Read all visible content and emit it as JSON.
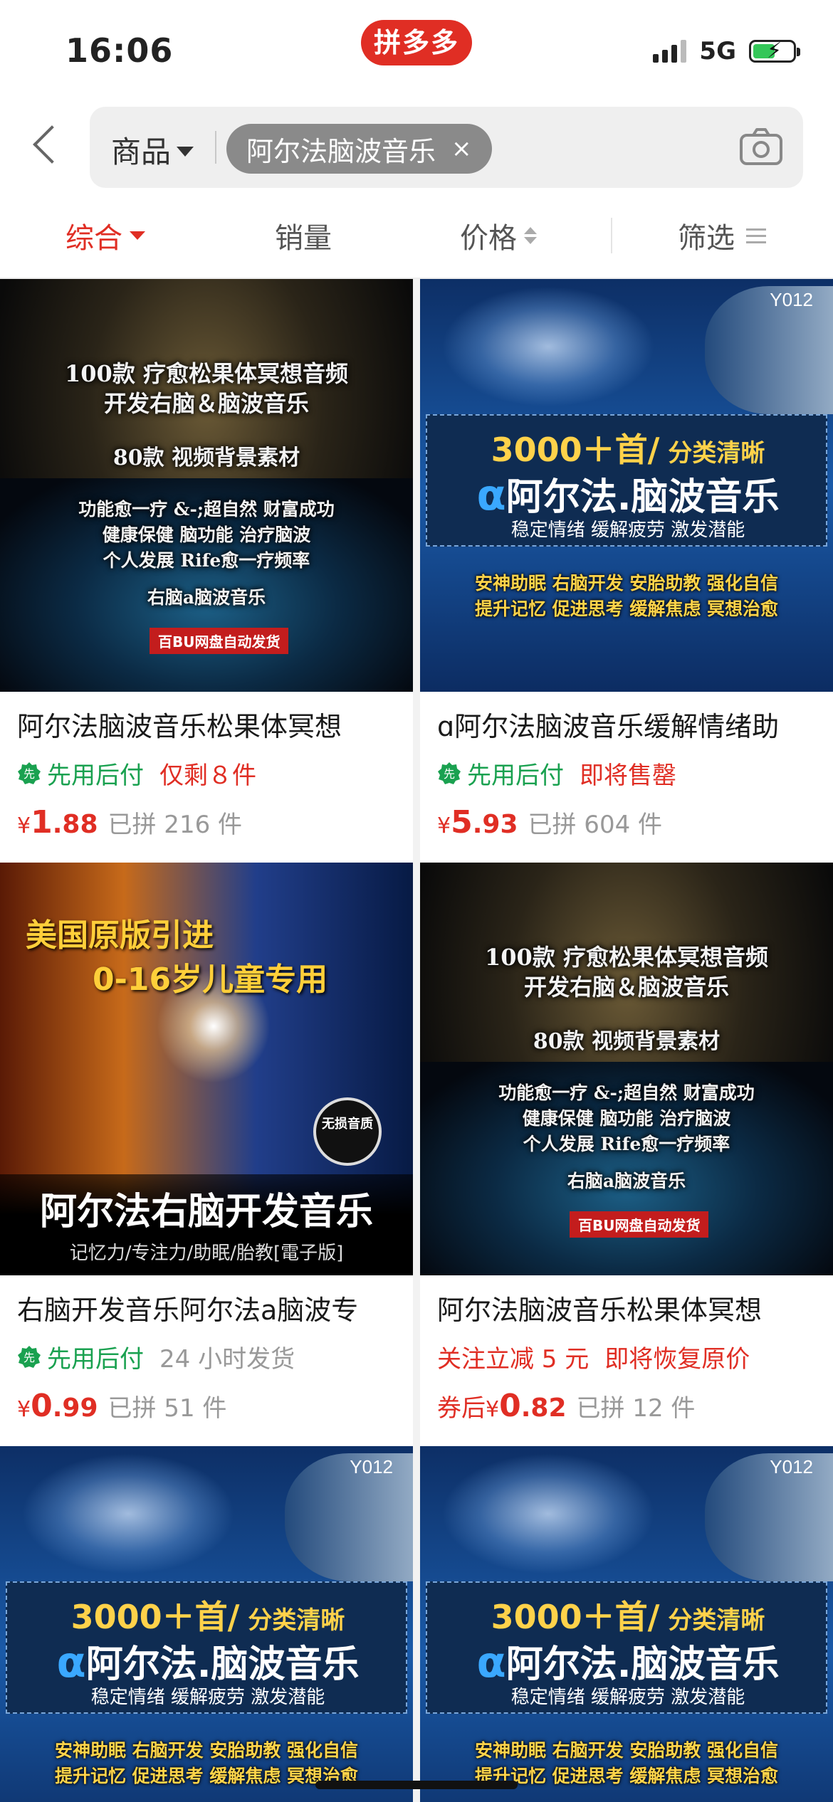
{
  "status_bar": {
    "time": "16:06",
    "app_logo": "拼多多",
    "network": "5G",
    "battery_charging": true
  },
  "search": {
    "category": "商品",
    "query": "阿尔法脑波音乐",
    "clear_icon": "×",
    "camera_icon": "camera-icon"
  },
  "sort": {
    "tabs": [
      {
        "label": "综合",
        "active": true
      },
      {
        "label": "销量",
        "active": false
      },
      {
        "label": "价格",
        "active": false
      },
      {
        "label": "筛选",
        "active": false
      }
    ]
  },
  "products": [
    {
      "title": "阿尔法脑波音乐松果体冥想",
      "tag1": "先用后付",
      "tag2": "仅剩８件",
      "price_prefix": "",
      "price_yen": "¥",
      "price_int": "1",
      "price_dec": ".88",
      "sold": "已拼 216 件",
      "art": {
        "lines": [
          "100款 疗愈松果体冥想音频",
          "开发右脑＆脑波音乐",
          "80款 视频背景素材",
          "功能愈一疗 &-;超自然 财富成功",
          "健康保健 脑功能 治疗脑波",
          "个人发展 Rife愈一疗频率",
          "右脑a脑波音乐"
        ],
        "stamp": "百BU网盘自动发货"
      }
    },
    {
      "title": "ɑ阿尔法脑波音乐缓解情绪助",
      "tag1": "先用后付",
      "tag2": "即将售罄",
      "price_prefix": "",
      "price_yen": "¥",
      "price_int": "5",
      "price_dec": ".93",
      "sold": "已拼 604 件",
      "art": {
        "code": "Y012",
        "hl1_main": "3000＋首/",
        "hl1_sub": " 分类清晰",
        "alpha": "α",
        "hl2": "阿尔法.脑波音乐",
        "hl3": "稳定情绪 缓解疲劳 激发潜能",
        "l1": "安神助眠 右脑开发 安胎助教 强化自信",
        "l2": "提升记忆 促进思考 缓解焦虑 冥想治愈"
      }
    },
    {
      "title": "右脑开发音乐阿尔法a脑波专",
      "tag1": "先用后付",
      "tag2": "24 小时发货",
      "price_prefix": "",
      "price_yen": "¥",
      "price_int": "0",
      "price_dec": ".99",
      "sold": "已拼 51 件",
      "art": {
        "top1": "美国原版引进",
        "top2": "0-16岁儿童专用",
        "seal": "无损音质",
        "bt1": "阿尔法右脑开发音乐",
        "bt2": "记忆力/专注力/助眠/胎教[電子版]"
      }
    },
    {
      "title": "阿尔法脑波音乐松果体冥想",
      "tag1": "关注立减 5 元",
      "tag2": "即将恢复原价",
      "price_prefix": "券后",
      "price_yen": "¥",
      "price_int": "0",
      "price_dec": ".82",
      "sold": "已拼 12 件",
      "art": {
        "lines": [
          "100款 疗愈松果体冥想音频",
          "开发右脑＆脑波音乐",
          "80款 视频背景素材",
          "功能愈一疗 &-;超自然 财富成功",
          "健康保健 脑功能 治疗脑波",
          "个人发展 Rife愈一疗频率",
          "右脑a脑波音乐"
        ],
        "stamp": "百BU网盘自动发货"
      }
    },
    {
      "art": {
        "code": "Y012",
        "hl1_main": "3000＋首/",
        "hl1_sub": " 分类清晰",
        "alpha": "α",
        "hl2": "阿尔法.脑波音乐",
        "hl3": "稳定情绪 缓解疲劳 激发潜能",
        "l1": "安神助眠 右脑开发 安胎助教 强化自信",
        "l2": "提升记忆 促进思考 缓解焦虑 冥想治愈"
      }
    },
    {
      "art": {
        "code": "Y012",
        "hl1_main": "3000＋首/",
        "hl1_sub": " 分类清晰",
        "alpha": "α",
        "hl2": "阿尔法.脑波音乐",
        "hl3": "稳定情绪 缓解疲劳 激发潜能",
        "l1": "安神助眠 右脑开发 安胎助教 强化自信",
        "l2": "提升记忆 促进思考 缓解焦虑 冥想治愈"
      }
    }
  ],
  "colors": {
    "brand_red": "#e02e24",
    "pay_later_green": "#1aa150",
    "muted_gray": "#999999"
  }
}
